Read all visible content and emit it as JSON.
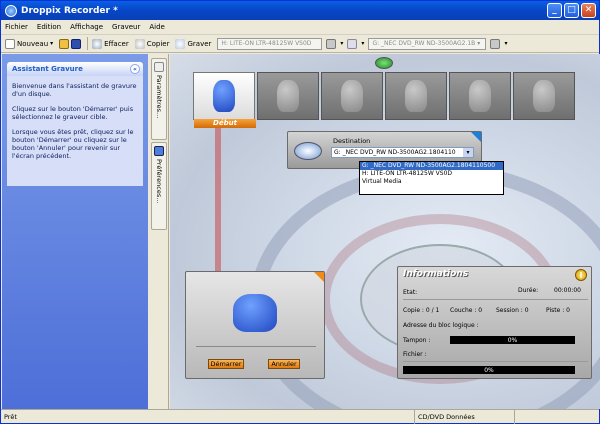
{
  "window": {
    "title": "Droppix Recorder *",
    "minimize_glyph": "_",
    "maximize_glyph": "□",
    "close_glyph": "✕"
  },
  "menu": {
    "items": [
      "Fichier",
      "Edition",
      "Affichage",
      "Graveur",
      "Aide"
    ]
  },
  "toolbar": {
    "new_label": "Nouveau",
    "new_caret": "▾",
    "erase_label": "Effacer",
    "copy_label": "Copier",
    "burn_label": "Graver",
    "drive1": "H: LITE-ON LTR-48125W     VS0D",
    "drive1_caret": "▾",
    "drive2_caret": "▾",
    "drive2": "G: _NEC   DVD_RW ND-3500AG2.1B",
    "drive2_end_caret": "▾",
    "drive3_caret": "▾"
  },
  "assistant": {
    "title": "Assistant Gravure",
    "collapse_glyph": "«",
    "paragraphs": [
      "Bienvenue dans l'assistant de gravure d'un disque.",
      "Cliquez sur le bouton 'Démarrer' puis sélectionnez le graveur cible.",
      "Lorsque vous êtes prêt, cliquez sur le bouton 'Démarrer' ou cliquez sur le bouton 'Annuler' pour revenir sur l'écran précédent."
    ]
  },
  "vtabs": {
    "params": "Paramètres...",
    "prefs": "Préférences..."
  },
  "steps": {
    "active_label": "Début"
  },
  "destination": {
    "label": "Destination",
    "selected": "G: _NEC   DVD_RW ND-3500AG2.1804110",
    "arrow": "▾",
    "options": [
      "G: _NEC   DVD_RW ND-3500AG2.1804110500",
      "H: LITE-ON LTR-48125W      VS0D",
      "Virtual Media"
    ]
  },
  "actions": {
    "start_label": "Démarrer",
    "cancel_label": "Annuler"
  },
  "info": {
    "title": "Informations",
    "icon_glyph": "i",
    "state_label": "Etat:",
    "duration_label": "Durée:",
    "duration_value": "00:00:00",
    "copy_label": "Copie : 0 / 1",
    "layer_label": "Couche : 0",
    "session_label": "Session : 0",
    "track_label": "Piste : 0",
    "block_label": "Adresse du bloc logique :",
    "buffer_label": "Tampon :",
    "buffer_value": "0%",
    "file_label": "Fichier :",
    "progress_value": "0%"
  },
  "status": {
    "left": "Prêt",
    "middle": "CD/DVD Données"
  }
}
